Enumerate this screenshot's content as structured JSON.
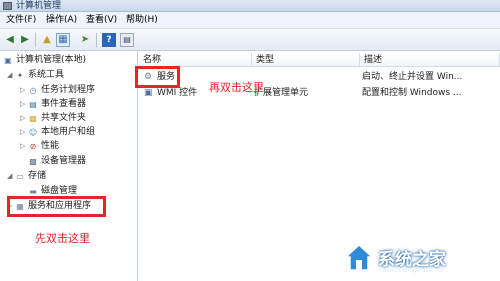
{
  "window": {
    "title": "计算机管理"
  },
  "menu": [
    {
      "label": "文件(F)"
    },
    {
      "label": "操作(A)"
    },
    {
      "label": "查看(V)"
    },
    {
      "label": "帮助(H)"
    }
  ],
  "toolbar": {
    "icons": [
      "back-icon",
      "forward-icon",
      "up-folder-icon",
      "console-tree-icon",
      "export-list-icon",
      "help-icon",
      "properties-icon"
    ]
  },
  "tree": {
    "root": "计算机管理(本地)",
    "system_tools": "系统工具",
    "task_scheduler": "任务计划程序",
    "event_viewer": "事件查看器",
    "shared_folders": "共享文件夹",
    "local_users": "本地用户和组",
    "performance": "性能",
    "device_manager": "设备管理器",
    "storage": "存储",
    "disk_management": "磁盘管理",
    "services_apps": "服务和应用程序"
  },
  "columns": {
    "name": "名称",
    "type": "类型",
    "desc": "描述"
  },
  "rows": [
    {
      "name": "服务",
      "type": "",
      "desc": "启动、终止并设置 Win..."
    },
    {
      "name": "WMI 控件",
      "type": "扩展管理单元",
      "desc": "配置和控制 Windows ..."
    }
  ],
  "annotations": {
    "double_click_here": "再双击这里",
    "double_click_first": "先双击这里"
  },
  "watermark": {
    "brand": "系统之家",
    "url": "www.xitongzhijia.net"
  },
  "colors": {
    "annotation_red": "#e8232a",
    "selection_blue": "#cce8ff"
  }
}
